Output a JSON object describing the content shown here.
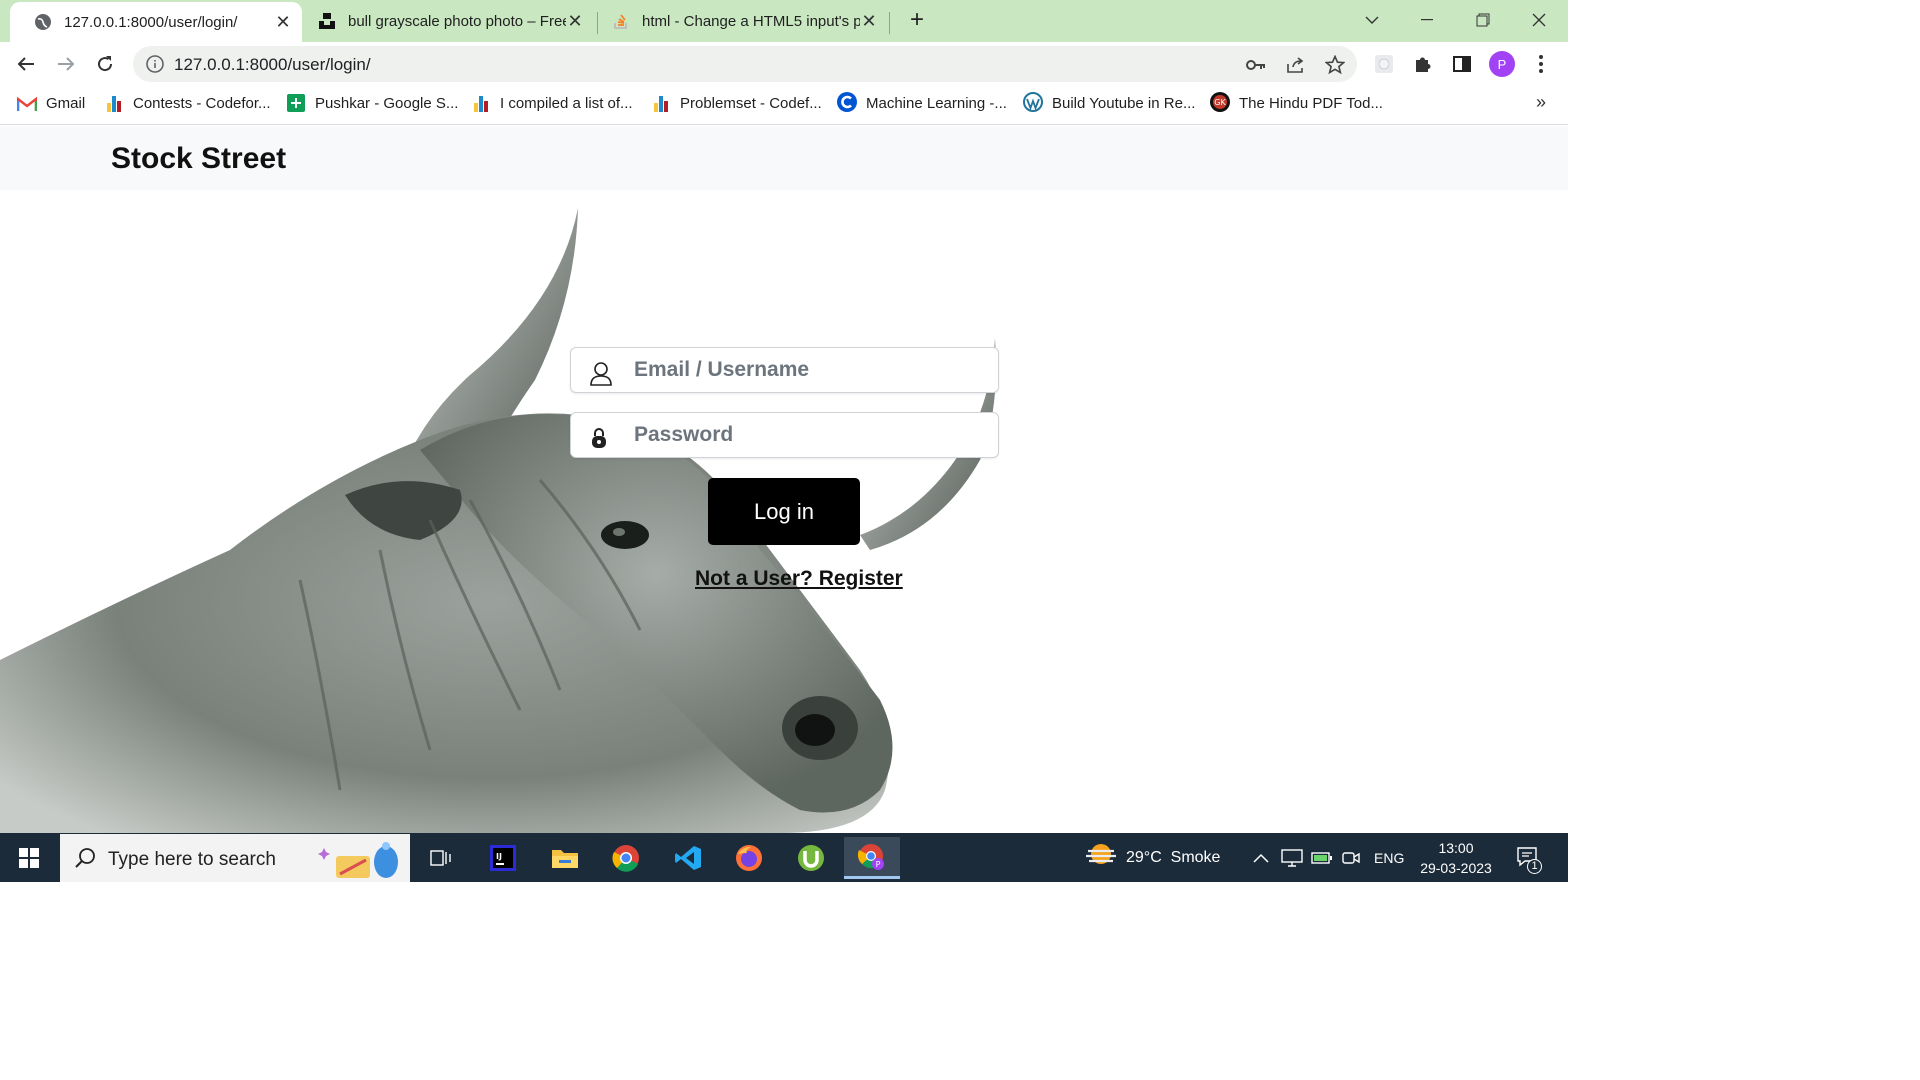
{
  "browser": {
    "tabs": [
      {
        "title": "127.0.0.1:8000/user/login/",
        "active": true,
        "icon": "globe-icon"
      },
      {
        "title": "bull grayscale photo photo – Free",
        "active": false,
        "icon": "unsplash-icon"
      },
      {
        "title": "html - Change a HTML5 input's p",
        "active": false,
        "icon": "stackoverflow-icon"
      }
    ],
    "new_tab_label": "+",
    "url": "127.0.0.1:8000/user/login/",
    "profile_initial": "P",
    "bookmarks": [
      {
        "label": "Gmail",
        "icon": "gmail-icon"
      },
      {
        "label": "Contests - Codefor...",
        "icon": "codeforces-icon"
      },
      {
        "label": "Pushkar - Google S...",
        "icon": "google-sheets-icon"
      },
      {
        "label": "I compiled a list of...",
        "icon": "codeforces-icon"
      },
      {
        "label": "Problemset - Codef...",
        "icon": "codeforces-icon"
      },
      {
        "label": "Machine Learning -...",
        "icon": "coursera-icon"
      },
      {
        "label": "Build Youtube in Re...",
        "icon": "wordpress-icon"
      },
      {
        "label": "The Hindu PDF Tod...",
        "icon": "gk-icon"
      }
    ],
    "bookmarks_more": "»"
  },
  "site": {
    "brand": "Stock Street",
    "email_placeholder": "Email / Username",
    "password_placeholder": "Password",
    "login_label": "Log in",
    "register_link": "Not a User? Register"
  },
  "taskbar": {
    "search_placeholder": "Type here to search",
    "weather": "29°C  Smoke",
    "language": "ENG",
    "time": "13:00",
    "date": "29-03-2023",
    "notification_count": "1"
  },
  "colors": {
    "tabstrip": "#c9e8c2",
    "taskbar": "#1c2b3a",
    "button": "#000000",
    "avatar": "#a142f4"
  }
}
